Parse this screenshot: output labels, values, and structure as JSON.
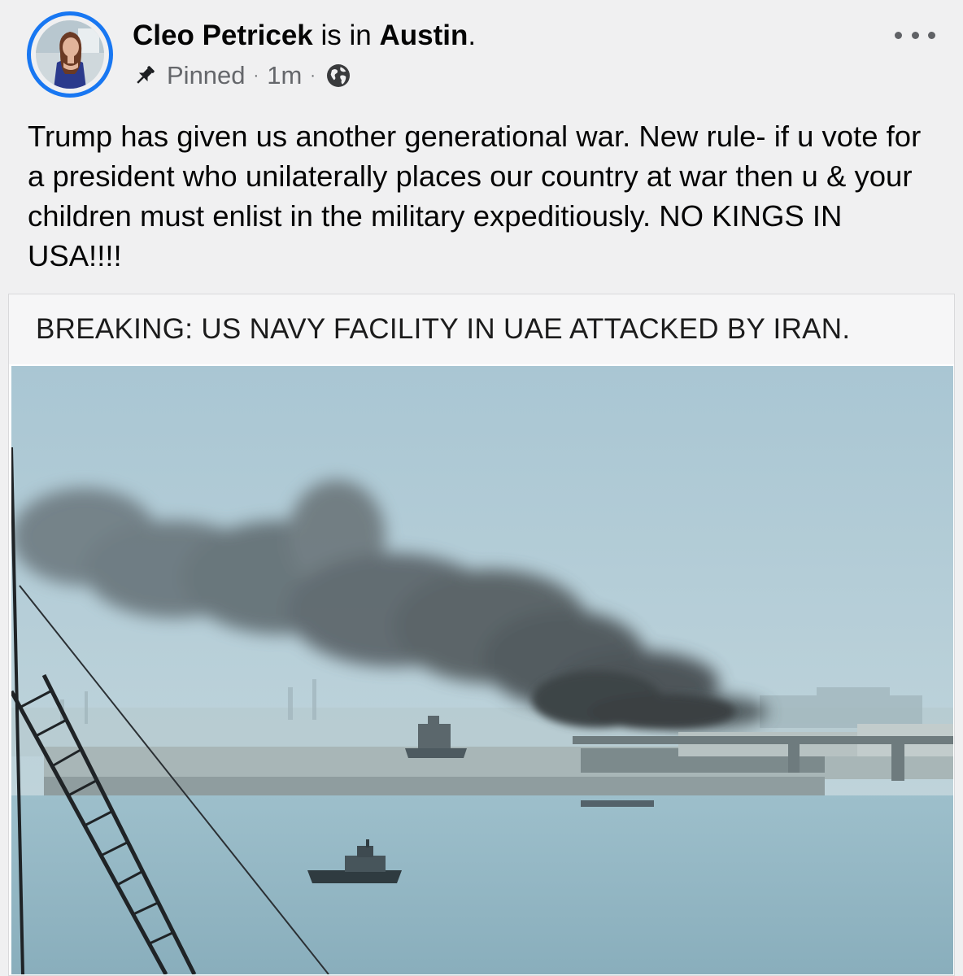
{
  "post": {
    "author": "Cleo Petricek",
    "location_prefix": "is in",
    "location": "Austin",
    "location_suffix": ".",
    "pinned_label": "Pinned",
    "time": "1m",
    "separator": "·",
    "text": "Trump has given us another generational war. New rule- if u vote for a president who unilaterally places our country at war then u & your children must enlist in the military expeditiously. NO KINGS IN USA!!!!"
  },
  "card": {
    "headline": "BREAKING: US NAVY FACILITY IN UAE ATTACKED BY IRAN."
  },
  "icons": {
    "pin": "pin-icon",
    "privacy": "globe-icon",
    "more": "more-options-icon"
  },
  "colors": {
    "background": "#f0f0f1",
    "avatar_ring": "#1877f2",
    "meta_text": "#65676b",
    "body_text": "#050505"
  }
}
